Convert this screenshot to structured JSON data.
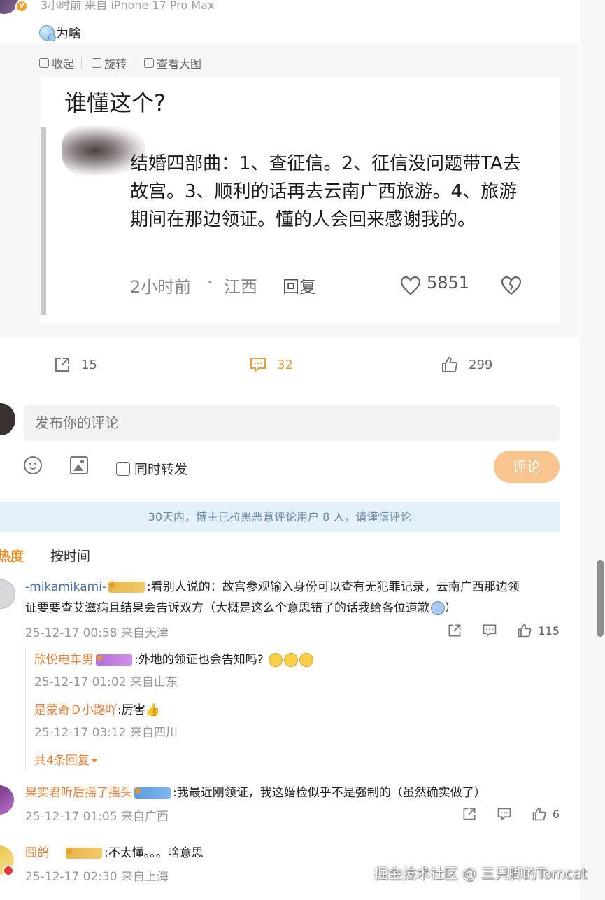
{
  "post": {
    "meta": "3小时前 来自 iPhone 17 Pro Max",
    "text": "为啥",
    "toolbar": {
      "collapse": "收起",
      "rotate": "旋转",
      "view_large": "查看大图"
    },
    "image": {
      "title": "谁懂这个?",
      "body": "结婚四部曲：1、查征信。2、征信没问题带TA去故宫。3、顺利的话再去云南广西旅游。4、旅游期间在那边领证。懂的人会回来感谢我的。",
      "time": "2小时前",
      "dot": "·",
      "location": "江西",
      "reply": "回复",
      "likes": "5851"
    },
    "actions": {
      "repost_count": "15",
      "comment_count": "32",
      "like_count": "299"
    }
  },
  "composer": {
    "placeholder": "发布你的评论",
    "also_repost": "同时转发",
    "submit": "评论"
  },
  "notice": "30天内，博主已拉黑恶意评论用户 8 人，请谨慎评论",
  "sort": {
    "hot": "热度",
    "time": "按时间"
  },
  "comments": [
    {
      "name": "-mikamikami-",
      "text_line1": ":看别人说的：故宫参观输入身份可以查有无犯罪记录，云南广西那边领",
      "text_line2": "证要要查艾滋病且结果会告诉双方（大概是这么个意思错了的话我给各位道歉",
      "time": "25-12-17 00:58 来自天津",
      "likes": "115",
      "replies": [
        {
          "name": "欣悦电车男",
          "text": ":外地的领证也会告知吗?",
          "time": "25-12-17 01:02 来自山东"
        },
        {
          "name": "是蒙奇Ｄ小路吖",
          "text": ":厉害",
          "time": "25-12-17 03:12 来自四川"
        }
      ],
      "more": "共4条回复"
    },
    {
      "name": "果实君听后摇了摇头",
      "text": ":我最近刚领证，我这婚检似乎不是强制的（虽然确实做了）",
      "time": "25-12-17 01:05 来自广西",
      "likes": "6"
    },
    {
      "name": "囧鸽",
      "text": ":不太懂。。。啥意思",
      "time": "25-12-17 02:30 来自上海"
    }
  ],
  "watermark": "掘金技术社区 @ 三只脚的Tomcat",
  "colors": {
    "accent_orange": "#ea7f3c",
    "submit_bg": "#f9c58e",
    "notice_bg": "#e4f0fb"
  }
}
